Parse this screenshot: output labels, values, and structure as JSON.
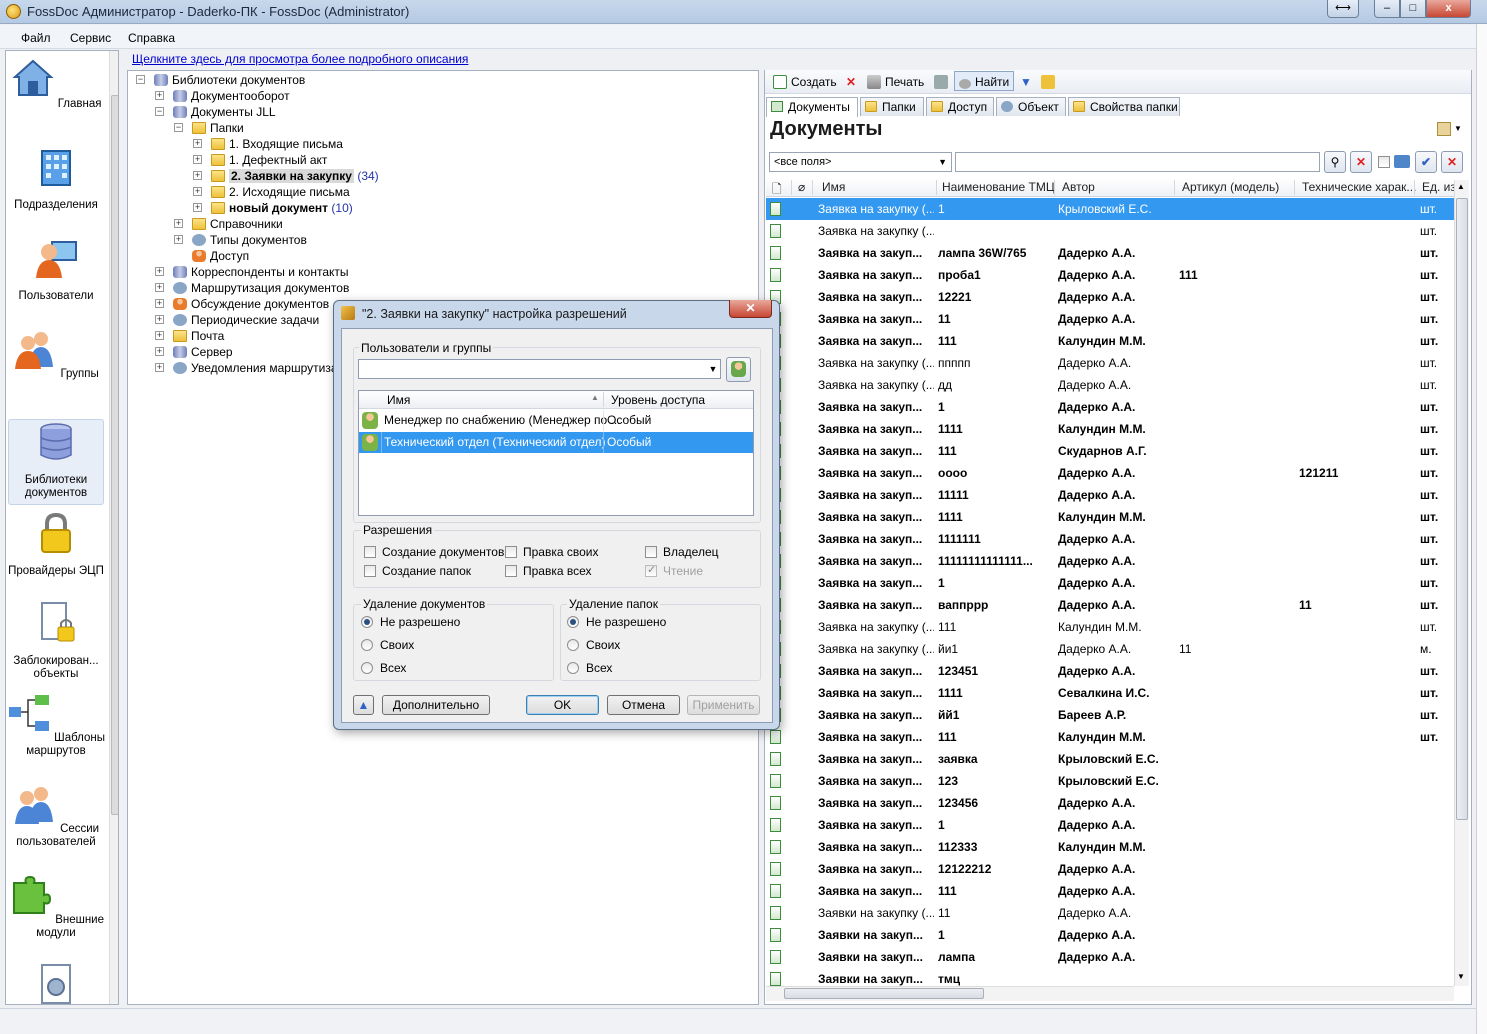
{
  "window": {
    "title": "FossDoc Администратор - Daderko-ПК - FossDoc (Administrator)",
    "close": "x",
    "minimize": "–",
    "maximize": "□",
    "restore": "⟷"
  },
  "menu": [
    "Файл",
    "Сервис",
    "Справка"
  ],
  "info_link": "Щелкните здесь для просмотра более подробного описания",
  "nav": [
    {
      "label": "Главная",
      "icon": "home-icon"
    },
    {
      "label": "Подразделения",
      "icon": "building-icon"
    },
    {
      "label": "Пользователи",
      "icon": "user-computer-icon"
    },
    {
      "label": "Группы",
      "icon": "group-icon"
    },
    {
      "label": "Библиотеки документов",
      "icon": "database-icon"
    },
    {
      "label": "Провайдеры ЭЦП",
      "icon": "lock-icon"
    },
    {
      "label": "Заблокирован... объекты",
      "icon": "locked-document-icon"
    },
    {
      "label": "Шаблоны маршрутов",
      "icon": "route-diagram-icon"
    },
    {
      "label": "Сессии пользователей",
      "icon": "users-session-icon"
    },
    {
      "label": "Внешние модули",
      "icon": "puzzle-icon"
    }
  ],
  "tree": [
    {
      "label": "Библиотеки документов",
      "level": 0,
      "exp": "−",
      "icon": "db"
    },
    {
      "label": "Документооборот",
      "level": 1,
      "exp": "+",
      "icon": "db"
    },
    {
      "label": "Документы JLL",
      "level": 1,
      "exp": "−",
      "icon": "db"
    },
    {
      "label": "Папки",
      "level": 2,
      "exp": "−",
      "icon": "folder"
    },
    {
      "label": "1. Входящие письма",
      "level": 3,
      "exp": "+",
      "icon": "folder"
    },
    {
      "label": "1. Дефектный акт",
      "level": 3,
      "exp": "+",
      "icon": "folder"
    },
    {
      "label": "2. Заявки на закупку",
      "level": 3,
      "exp": "+",
      "icon": "folder",
      "bold": true,
      "selected": true,
      "count": "(34)"
    },
    {
      "label": "2. Исходящие письма",
      "level": 3,
      "exp": "+",
      "icon": "folder"
    },
    {
      "label": "новый документ",
      "level": 3,
      "exp": "+",
      "icon": "folder",
      "bold": true,
      "count": "(10)"
    },
    {
      "label": "Справочники",
      "level": 2,
      "exp": "+",
      "icon": "folder"
    },
    {
      "label": "Типы документов",
      "level": 2,
      "exp": "+",
      "icon": "gear"
    },
    {
      "label": "Доступ",
      "level": 2,
      "exp": "",
      "icon": "user"
    },
    {
      "label": "Корреспонденты и контакты",
      "level": 1,
      "exp": "+",
      "icon": "db"
    },
    {
      "label": "Маршрутизация документов",
      "level": 1,
      "exp": "+",
      "icon": "gear"
    },
    {
      "label": "Обсуждение документов",
      "level": 1,
      "exp": "+",
      "icon": "user"
    },
    {
      "label": "Периодические задачи",
      "level": 1,
      "exp": "+",
      "icon": "gear"
    },
    {
      "label": "Почта",
      "level": 1,
      "exp": "+",
      "icon": "folder"
    },
    {
      "label": "Сервер",
      "level": 1,
      "exp": "+",
      "icon": "db"
    },
    {
      "label": "Уведомления маршрутизаци",
      "level": 1,
      "exp": "+",
      "icon": "gear"
    }
  ],
  "toolbar": {
    "create": "Создать",
    "print": "Печать",
    "find": "Найти"
  },
  "tabs": [
    "Документы",
    "Папки",
    "Доступ",
    "Объект",
    "Свойства папки"
  ],
  "docs_title": "Документы",
  "field_select": "<все поля>",
  "search_value": "",
  "grid_headers": [
    "Имя",
    "Наименование ТМЦ",
    "Автор",
    "Артикул (модель)",
    "Технические харак...",
    "Ед. из"
  ],
  "grid_rows": [
    {
      "name": "Заявка на закупку (...",
      "tmc": "1",
      "author": "Крыловский Е.С.",
      "art": "",
      "tech": "",
      "unit": "шт.",
      "bold": false,
      "selected": true
    },
    {
      "name": "Заявка на закупку (...",
      "tmc": "",
      "author": "",
      "art": "",
      "tech": "",
      "unit": "шт.",
      "bold": false
    },
    {
      "name": "Заявка на закуп...",
      "tmc": "лампа 36W/765",
      "author": "Дадерко А.А.",
      "art": "",
      "tech": "",
      "unit": "шт.",
      "bold": true
    },
    {
      "name": "Заявка на закуп...",
      "tmc": "проба1",
      "author": "Дадерко А.А.",
      "art": "111",
      "tech": "",
      "unit": "шт.",
      "bold": true
    },
    {
      "name": "Заявка на закуп...",
      "tmc": "12221",
      "author": "Дадерко А.А.",
      "art": "",
      "tech": "",
      "unit": "шт.",
      "bold": true
    },
    {
      "name": "Заявка на закуп...",
      "tmc": "11",
      "author": "Дадерко А.А.",
      "art": "",
      "tech": "",
      "unit": "шт.",
      "bold": true
    },
    {
      "name": "Заявка на закуп...",
      "tmc": "111",
      "author": "Калундин М.М.",
      "art": "",
      "tech": "",
      "unit": "шт.",
      "bold": true
    },
    {
      "name": "Заявка на закупку (...",
      "tmc": "ппппп",
      "author": "Дадерко А.А.",
      "art": "",
      "tech": "",
      "unit": "шт.",
      "bold": false
    },
    {
      "name": "Заявка на закупку (...",
      "tmc": "дд",
      "author": "Дадерко А.А.",
      "art": "",
      "tech": "",
      "unit": "шт.",
      "bold": false
    },
    {
      "name": "Заявка на закуп...",
      "tmc": "1",
      "author": "Дадерко А.А.",
      "art": "",
      "tech": "",
      "unit": "шт.",
      "bold": true
    },
    {
      "name": "Заявка на закуп...",
      "tmc": "1111",
      "author": "Калундин М.М.",
      "art": "",
      "tech": "",
      "unit": "шт.",
      "bold": true
    },
    {
      "name": "Заявка на закуп...",
      "tmc": "111",
      "author": "Скударнов А.Г.",
      "art": "",
      "tech": "",
      "unit": "шт.",
      "bold": true
    },
    {
      "name": "Заявка на закуп...",
      "tmc": "оооо",
      "author": "Дадерко А.А.",
      "art": "",
      "tech": "121211",
      "unit": "шт.",
      "bold": true
    },
    {
      "name": "Заявка на закуп...",
      "tmc": "11111",
      "author": "Дадерко А.А.",
      "art": "",
      "tech": "",
      "unit": "шт.",
      "bold": true
    },
    {
      "name": "Заявка на закуп...",
      "tmc": "1111",
      "author": "Калундин М.М.",
      "art": "",
      "tech": "",
      "unit": "шт.",
      "bold": true
    },
    {
      "name": "Заявка на закуп...",
      "tmc": "1111111",
      "author": "Дадерко А.А.",
      "art": "",
      "tech": "",
      "unit": "шт.",
      "bold": true
    },
    {
      "name": "Заявка на закуп...",
      "tmc": "11111111111111...",
      "author": "Дадерко А.А.",
      "art": "",
      "tech": "",
      "unit": "шт.",
      "bold": true
    },
    {
      "name": "Заявка на закуп...",
      "tmc": "1",
      "author": "Дадерко А.А.",
      "art": "",
      "tech": "",
      "unit": "шт.",
      "bold": true
    },
    {
      "name": "Заявка на закуп...",
      "tmc": "ваппррр",
      "author": "Дадерко А.А.",
      "art": "",
      "tech": "11",
      "unit": "шт.",
      "bold": true
    },
    {
      "name": "Заявка на закупку (...",
      "tmc": "111",
      "author": "Калундин М.М.",
      "art": "",
      "tech": "",
      "unit": "шт.",
      "bold": false
    },
    {
      "name": "Заявка на закупку (...",
      "tmc": "йи1",
      "author": "Дадерко А.А.",
      "art": "11",
      "tech": "",
      "unit": "м.",
      "bold": false
    },
    {
      "name": "Заявка на закуп...",
      "tmc": "123451",
      "author": "Дадерко А.А.",
      "art": "",
      "tech": "",
      "unit": "шт.",
      "bold": true
    },
    {
      "name": "Заявка на закуп...",
      "tmc": "1111",
      "author": "Севалкина И.С.",
      "art": "",
      "tech": "",
      "unit": "шт.",
      "bold": true
    },
    {
      "name": "Заявка на закуп...",
      "tmc": "йй1",
      "author": "Бареев А.Р.",
      "art": "",
      "tech": "",
      "unit": "шт.",
      "bold": true
    },
    {
      "name": "Заявка на закуп...",
      "tmc": "111",
      "author": "Калундин М.М.",
      "art": "",
      "tech": "",
      "unit": "шт.",
      "bold": true
    },
    {
      "name": "Заявка на закуп...",
      "tmc": "заявка",
      "author": "Крыловский Е.С.",
      "art": "",
      "tech": "",
      "unit": "",
      "bold": true
    },
    {
      "name": "Заявка на закуп...",
      "tmc": "123",
      "author": "Крыловский Е.С.",
      "art": "",
      "tech": "",
      "unit": "",
      "bold": true
    },
    {
      "name": "Заявка на закуп...",
      "tmc": "123456",
      "author": "Дадерко А.А.",
      "art": "",
      "tech": "",
      "unit": "",
      "bold": true
    },
    {
      "name": "Заявка на закуп...",
      "tmc": "1",
      "author": "Дадерко А.А.",
      "art": "",
      "tech": "",
      "unit": "",
      "bold": true
    },
    {
      "name": "Заявка на закуп...",
      "tmc": "112333",
      "author": "Калундин М.М.",
      "art": "",
      "tech": "",
      "unit": "",
      "bold": true
    },
    {
      "name": "Заявка на закуп...",
      "tmc": "12122212",
      "author": "Дадерко А.А.",
      "art": "",
      "tech": "",
      "unit": "",
      "bold": true
    },
    {
      "name": "Заявка на закуп...",
      "tmc": "111",
      "author": "Дадерко А.А.",
      "art": "",
      "tech": "",
      "unit": "",
      "bold": true
    },
    {
      "name": "Заявки на закупку (...",
      "tmc": "11",
      "author": "Дадерко А.А.",
      "art": "",
      "tech": "",
      "unit": "",
      "bold": false
    },
    {
      "name": "Заявки на закуп...",
      "tmc": "1",
      "author": "Дадерко А.А.",
      "art": "",
      "tech": "",
      "unit": "",
      "bold": true
    },
    {
      "name": "Заявки на закуп...",
      "tmc": "лампа",
      "author": "Дадерко А.А.",
      "art": "",
      "tech": "",
      "unit": "",
      "bold": true
    },
    {
      "name": "Заявки на закуп...",
      "tmc": "тмц",
      "author": "",
      "art": "",
      "tech": "",
      "unit": "",
      "bold": true
    }
  ],
  "dialog": {
    "title": "\"2. Заявки на закупку\" настройка разрешений",
    "users_groups_label": "Пользователи и группы",
    "col_name": "Имя",
    "col_level": "Уровень доступа",
    "entries": [
      {
        "name": "Менеджер по снабжению (Менеджер по ...",
        "level": "Особый",
        "selected": false
      },
      {
        "name": "Технический отдел (Технический отдел)",
        "level": "Особый",
        "selected": true
      }
    ],
    "permissions_label": "Разрешения",
    "perm": {
      "create_docs": "Создание документов",
      "edit_own": "Правка своих",
      "owner": "Владелец",
      "create_folders": "Создание папок",
      "edit_all": "Правка всех",
      "read": "Чтение"
    },
    "del_docs_label": "Удаление документов",
    "del_folders_label": "Удаление папок",
    "radio": {
      "not_allowed": "Не разрешено",
      "own": "Своих",
      "all": "Всех"
    },
    "buttons": {
      "more": "Дополнительно",
      "ok": "OK",
      "cancel": "Отмена",
      "apply": "Применить"
    }
  }
}
